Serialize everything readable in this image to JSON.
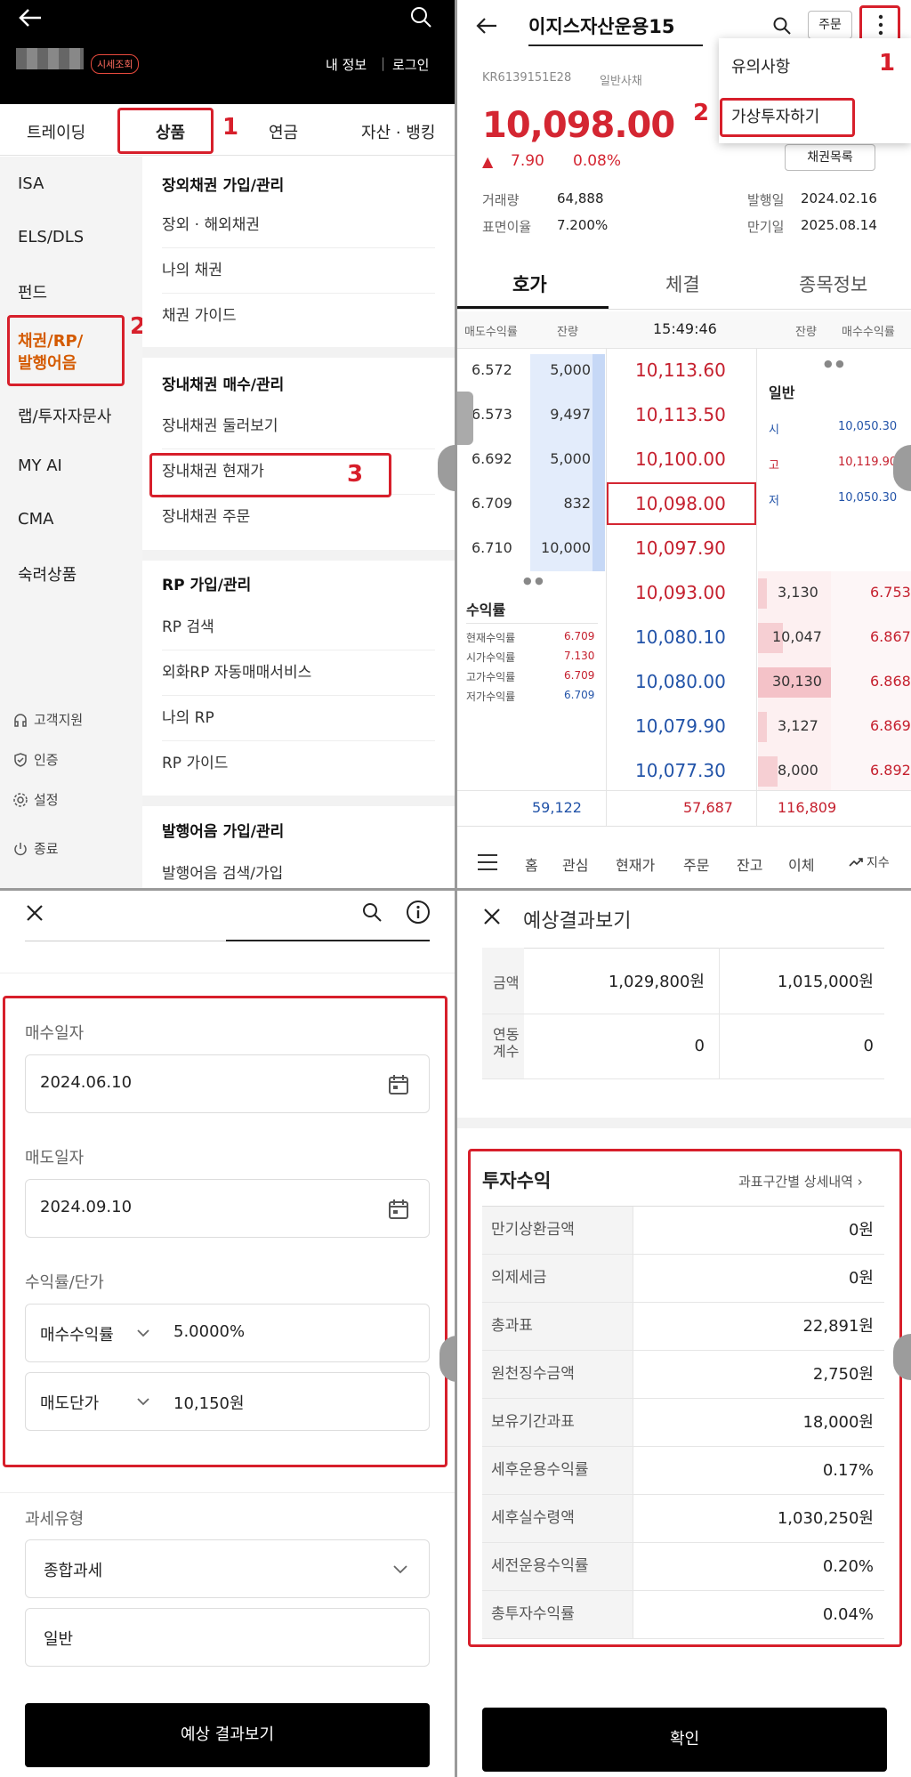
{
  "panel1": {
    "badge": "시세조회",
    "my_info": "내 정보",
    "login": "로그인",
    "tabs": [
      "트레이딩",
      "상품",
      "연금",
      "자산 · 뱅킹"
    ],
    "side_items": [
      "ISA",
      "ELS/DLS",
      "펀드",
      "채권/RP/\n발행어음",
      "랩/투자자문사",
      "MY AI",
      "CMA",
      "숙려상품"
    ],
    "side_footer": [
      "고객지원",
      "인증",
      "설정",
      "종료"
    ],
    "sections": [
      {
        "title": "장외채권 가입/관리",
        "items": [
          "장외 · 해외채권",
          "나의 채권",
          "채권 가이드"
        ]
      },
      {
        "title": "장내채권 매수/관리",
        "items": [
          "장내채권 둘러보기",
          "장내채권 현재가",
          "장내채권 주문"
        ]
      },
      {
        "title": "RP 가입/관리",
        "items": [
          "RP 검색",
          "외화RP 자동매매서비스",
          "나의 RP",
          "RP 가이드"
        ]
      },
      {
        "title": "발행어음 가입/관리",
        "items": [
          "발행어음 검색/가입"
        ]
      }
    ],
    "marks": [
      "1",
      "2",
      "3"
    ]
  },
  "panel2": {
    "title": "이지스자산운용15",
    "order_btn": "주문",
    "code": "KR6139151E28",
    "type": "일반사채",
    "price": "10,098.00",
    "change": "7.90",
    "change_pct": "0.08%",
    "bond_list_btn": "채권목록",
    "menu": [
      "유의사항",
      "가상투자하기"
    ],
    "marks": [
      "1",
      "2"
    ],
    "info": {
      "volume_lbl": "거래량",
      "volume": "64,888",
      "coupon_lbl": "표면이율",
      "coupon": "7.200%",
      "issue_lbl": "발행일",
      "issue": "2024.02.16",
      "maturity_lbl": "만기일",
      "maturity": "2025.08.14"
    },
    "tabs": [
      "호가",
      "체결",
      "종목정보"
    ],
    "ob_headers": [
      "매도수익률",
      "잔량",
      "15:49:46",
      "잔량",
      "매수수익률"
    ],
    "asks": [
      {
        "yield": "6.572",
        "qty": "5,000",
        "price": "10,113.60"
      },
      {
        "yield": "6.573",
        "qty": "9,497",
        "price": "10,113.50"
      },
      {
        "yield": "6.692",
        "qty": "5,000",
        "price": "10,100.00"
      },
      {
        "yield": "6.709",
        "qty": "832",
        "price": "10,098.00"
      },
      {
        "yield": "6.710",
        "qty": "10,000",
        "price": "10,097.90"
      }
    ],
    "bids": [
      {
        "price": "10,093.00",
        "qty": "3,130",
        "yield": "6.753"
      },
      {
        "price": "10,080.10",
        "qty": "10,047",
        "yield": "6.867"
      },
      {
        "price": "10,080.00",
        "qty": "30,130",
        "yield": "6.868"
      },
      {
        "price": "10,079.90",
        "qty": "3,127",
        "yield": "6.869"
      },
      {
        "price": "10,077.30",
        "qty": "8,000",
        "yield": "6.892"
      }
    ],
    "general": {
      "title": "일반",
      "rows": [
        [
          "시",
          "10,050.30"
        ],
        [
          "고",
          "10,119.90"
        ],
        [
          "저",
          "10,050.30"
        ]
      ]
    },
    "yields": {
      "title": "수익률",
      "rows": [
        [
          "현재수익률",
          "6.709"
        ],
        [
          "시가수익률",
          "7.130"
        ],
        [
          "고가수익률",
          "6.709"
        ],
        [
          "저가수익률",
          "6.709"
        ]
      ]
    },
    "totals": [
      "59,122",
      "57,687",
      "116,809"
    ],
    "bottom_nav": [
      "홈",
      "관심",
      "현재가",
      "주문",
      "잔고",
      "이체",
      "지수"
    ]
  },
  "panel3": {
    "buy_date_lbl": "매수일자",
    "buy_date": "2024.06.10",
    "sell_date_lbl": "매도일자",
    "sell_date": "2024.09.10",
    "rate_lbl": "수익률/단가",
    "rate1_type": "매수수익률",
    "rate1_val": "5.0000%",
    "rate2_type": "매도단가",
    "rate2_val": "10,150원",
    "tax_lbl": "과세유형",
    "tax_type": "종합과세",
    "tax_sub": "일반",
    "button": "예상 결과보기"
  },
  "panel4": {
    "title": "예상결과보기",
    "top_rows": [
      {
        "k": "금액",
        "v1": "1,029,800원",
        "v2": "1,015,000원"
      },
      {
        "k": "연동\n계수",
        "v1": "0",
        "v2": "0"
      }
    ],
    "section_title": "투자수익",
    "detail_link": "과표구간별 상세내역",
    "rows": [
      [
        "만기상환금액",
        "0원"
      ],
      [
        "의제세금",
        "0원"
      ],
      [
        "총과표",
        "22,891원"
      ],
      [
        "원천징수금액",
        "2,750원"
      ],
      [
        "보유기간과표",
        "18,000원"
      ],
      [
        "세후운용수익률",
        "0.17%"
      ],
      [
        "세후실수령액",
        "1,030,250원"
      ],
      [
        "세전운용수익률",
        "0.20%"
      ],
      [
        "총투자수익률",
        "0.04%"
      ]
    ],
    "button": "확인"
  }
}
